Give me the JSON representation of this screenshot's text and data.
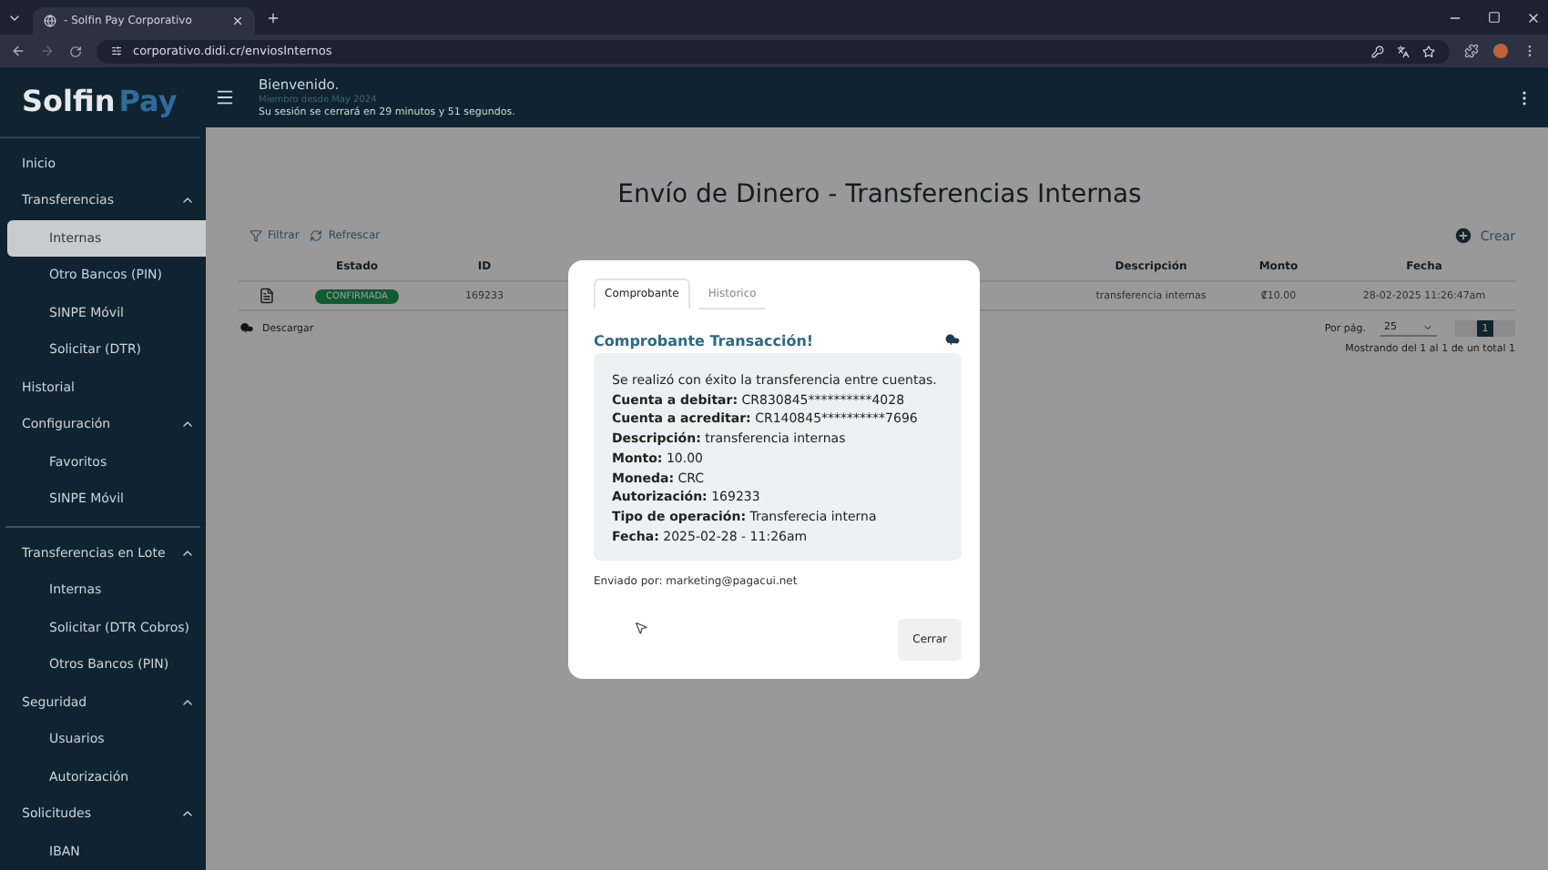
{
  "browser": {
    "tab_title": "- Solfin Pay Corporativo",
    "url": "corporativo.didi.cr/enviosInternos"
  },
  "header": {
    "logo_first": "Solfin",
    "logo_second": "Pay",
    "greeting": "Bienvenido.",
    "member_since": "Miembro desde May 2024",
    "session_notice": "Su sesión se cerrará en 29 minutos y 51 segundos."
  },
  "sidebar": {
    "items": [
      {
        "label": "Inicio",
        "selected": false
      },
      {
        "label": "Transferencias",
        "expanded": true,
        "children": [
          {
            "label": "Internas",
            "selected": true
          },
          {
            "label": "Otro Bancos (PIN)",
            "selected": false
          },
          {
            "label": "SINPE Móvil",
            "selected": false
          },
          {
            "label": "Solicitar (DTR)",
            "selected": false
          }
        ]
      },
      {
        "label": "Historial",
        "selected": false
      },
      {
        "label": "Configuración",
        "expanded": true,
        "divider_after": true,
        "children": [
          {
            "label": "Favoritos",
            "selected": false
          },
          {
            "label": "SINPE Móvil",
            "selected": false
          }
        ]
      },
      {
        "label": "Transferencias en Lote",
        "expanded": true,
        "children": [
          {
            "label": "Internas",
            "selected": false
          },
          {
            "label": "Solicitar (DTR Cobros)",
            "selected": false
          },
          {
            "label": "Otros Bancos (PIN)",
            "selected": false
          }
        ]
      },
      {
        "label": "Seguridad",
        "expanded": true,
        "children": [
          {
            "label": "Usuarios",
            "selected": false
          },
          {
            "label": "Autorización",
            "selected": false
          }
        ]
      },
      {
        "label": "Solicitudes",
        "expanded": true,
        "children": [
          {
            "label": "IBAN",
            "selected": false
          }
        ]
      }
    ]
  },
  "page": {
    "title": "Envío de Dinero - Transferencias Internas",
    "filter": "Filtrar",
    "refresh": "Refrescar",
    "create": "Crear",
    "download": "Descargar"
  },
  "table": {
    "columns": [
      "Estado",
      "ID",
      "Descripción",
      "Monto",
      "Fecha"
    ],
    "rows": [
      {
        "status": "CONFIRMADA",
        "id": "169233",
        "description": "transferencia internas",
        "amount": "₡10.00",
        "date": "28-02-2025 11:26:47am"
      }
    ]
  },
  "pagination": {
    "per_page_label": "Por pág.",
    "per_page": "25",
    "pages": [
      {
        "label": "1",
        "selected": true
      }
    ],
    "summary": "Mostrando del 1 al 1 de un total 1"
  },
  "modal": {
    "tabs": [
      {
        "label": "Comprobante",
        "selected": true
      },
      {
        "label": "Historico",
        "selected": false
      }
    ],
    "title": "Comprobante Transacción!",
    "message": "Se realizó con éxito la transferencia entre cuentas.",
    "fields": [
      {
        "label": "Cuenta a debitar:",
        "value": "CR830845**********4028"
      },
      {
        "label": "Cuenta a acreditar:",
        "value": "CR140845**********7696"
      },
      {
        "label": "Descripción:",
        "value": "transferencia internas"
      },
      {
        "label": "Monto:",
        "value": "10.00"
      },
      {
        "label": "Moneda:",
        "value": "CRC"
      },
      {
        "label": "Autorización:",
        "value": "169233"
      },
      {
        "label": "Tipo de operación:",
        "value": "Transferecia interna"
      },
      {
        "label": "Fecha:",
        "value": "2025-02-28 - 11:26am"
      }
    ],
    "sent_by": "Enviado por: marketing@pagacui.net",
    "close": "Cerrar"
  }
}
